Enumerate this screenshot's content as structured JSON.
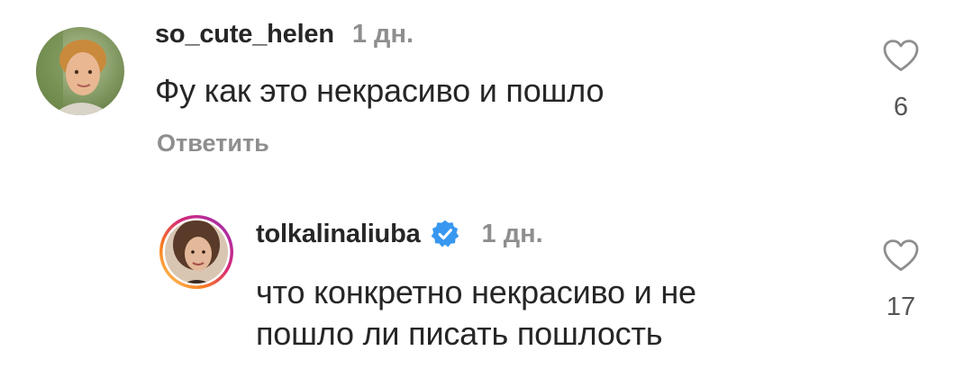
{
  "comments": [
    {
      "username": "so_cute_helen",
      "time": "1 дн.",
      "text": "Фу как это некрасиво и пошло",
      "reply_label": "Ответить",
      "likes": "6",
      "verified": false
    },
    {
      "username": "tolkalinaliuba",
      "time": "1 дн.",
      "text_line1": "что конкретно некрасиво и не",
      "text_line2": "пошло ли писать пошлость",
      "likes": "17",
      "verified": true,
      "has_story_ring": true
    }
  ],
  "colors": {
    "text": "#262626",
    "secondary": "#8e8e8e",
    "verified": "#3897f0"
  },
  "icons": {
    "like": "heart-outline-icon",
    "verified": "verified-badge-icon"
  }
}
